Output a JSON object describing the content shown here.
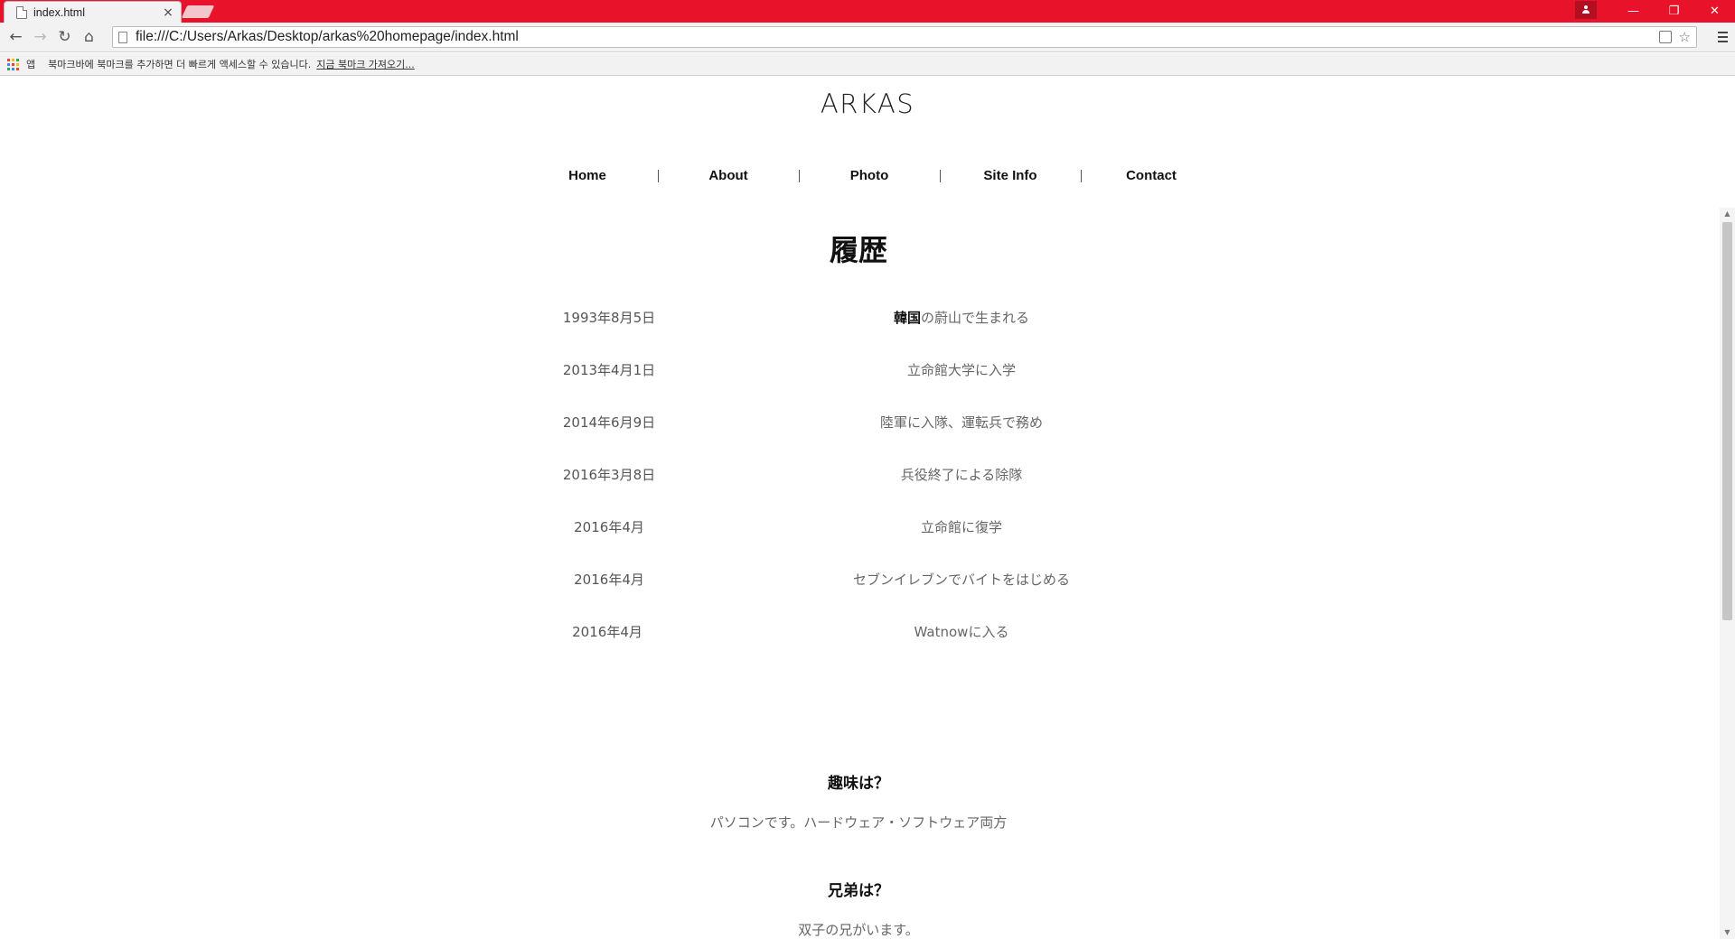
{
  "browser": {
    "tab_title": "index.html",
    "tab_close": "×",
    "url": "file:///C:/Users/Arkas/Desktop/arkas%20homepage/index.html",
    "window_buttons": {
      "minimize": "—",
      "restore": "❐",
      "close": "✕"
    },
    "nav": {
      "back": "←",
      "forward": "→",
      "reload": "↻",
      "home": "⌂"
    },
    "omnibox_icons": {
      "translate": "translate-icon",
      "star": "☆"
    },
    "bookmarks_bar": {
      "apps_label": "앱",
      "message": "북마크바에 북마크를 추가하면 더 빠르게 액세스할 수 있습니다.",
      "import_link": "지금 북마크 가져오기..."
    },
    "accent_color": "#e8132a",
    "apps_icon_colors": [
      "#ea4335",
      "#fbbc05",
      "#34a853",
      "#4285f4",
      "#ea4335",
      "#fbbc05",
      "#34a853",
      "#4285f4",
      "#ea4335"
    ]
  },
  "site": {
    "title": "ARKAS",
    "nav": [
      "Home",
      "About",
      "Photo",
      "Site Info",
      "Contact"
    ]
  },
  "history": {
    "heading": "履歴",
    "rows": [
      {
        "date": "1993年8月5日",
        "desc_bold": "韓国",
        "desc": "の蔚山で生まれる"
      },
      {
        "date": "2013年4月1日",
        "desc_bold": "",
        "desc": "立命館大学に入学"
      },
      {
        "date": "2014年6月9日",
        "desc_bold": "",
        "desc": "陸軍に入隊、運転兵で務め"
      },
      {
        "date": "2016年3月8日",
        "desc_bold": "",
        "desc": "兵役終了による除隊"
      },
      {
        "date": "2016年4月",
        "desc_bold": "",
        "desc": "立命館に復学"
      },
      {
        "date": "2016年4月",
        "desc_bold": "",
        "desc": "セブンイレブンでバイトをはじめる"
      },
      {
        "date": "2016年4月",
        "desc_bold": "",
        "desc": "Watnowに入る"
      }
    ]
  },
  "faq": [
    {
      "q": "趣味は？",
      "a": "パソコンです。ハードウェア・ソフトウェア両方"
    },
    {
      "q": "兄弟は？",
      "a": "双子の兄がいます。"
    }
  ]
}
